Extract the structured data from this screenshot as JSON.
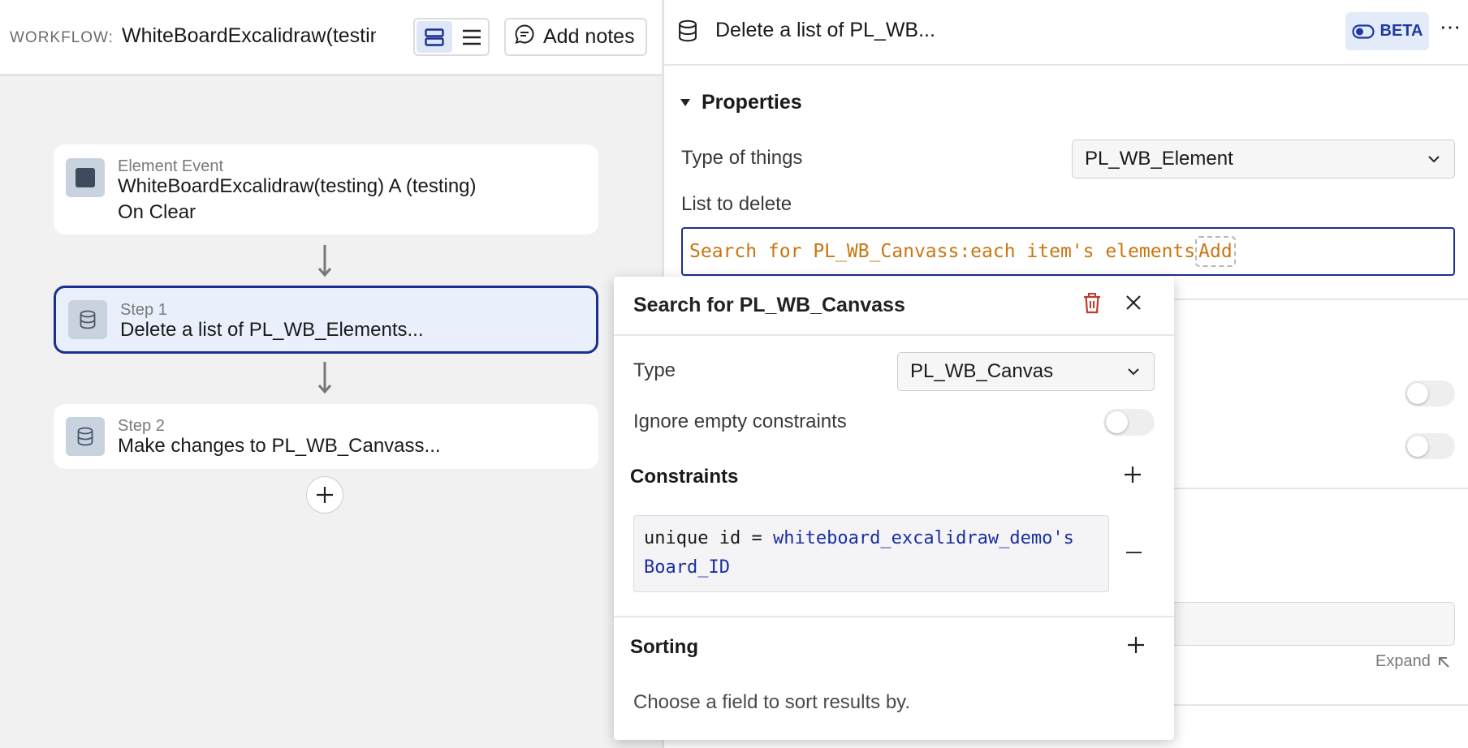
{
  "workflow": {
    "label": "WORKFLOW:",
    "name": "WhiteBoardExcalidraw(testing)",
    "add_notes_label": "Add notes",
    "view_icons": [
      "card-view-icon",
      "list-view-icon"
    ]
  },
  "steps": [
    {
      "subtitle": "Element Event",
      "title_line1": "WhiteBoardExcalidraw(testing) A (testing)",
      "title_line2": "On Clear",
      "icon": "stop-square-icon"
    },
    {
      "subtitle": "Step 1",
      "title": "Delete a list of PL_WB_Elements...",
      "icon": "database-icon",
      "selected": true
    },
    {
      "subtitle": "Step 2",
      "title": "Make changes to PL_WB_Canvass...",
      "icon": "database-icon"
    }
  ],
  "panel": {
    "title": "Delete a list of PL_WB...",
    "beta_label": "BETA",
    "more_label": "⋯",
    "properties_label": "Properties",
    "type_label": "Type of things",
    "type_value": "PL_WB_Element",
    "list_label": "List to delete",
    "list_expression": "Search for PL_WB_Canvass:each item's elements",
    "add_label": "Add",
    "expand_label": "Expand"
  },
  "popover": {
    "title": "Search for PL_WB_Canvass",
    "type_label": "Type",
    "type_value": "PL_WB_Canvas",
    "ignore_label": "Ignore empty constraints",
    "ignore_on": false,
    "constraints_label": "Constraints",
    "constraint_field": "unique id =",
    "constraint_value": "whiteboard_excalidraw_demo's Board_ID",
    "sorting_label": "Sorting",
    "sorting_hint": "Choose a field to sort results by."
  },
  "colors": {
    "accent": "#1b2f8f",
    "expression": "#c97612",
    "dynamic": "#1b2fa0",
    "delete": "#c0392b"
  }
}
